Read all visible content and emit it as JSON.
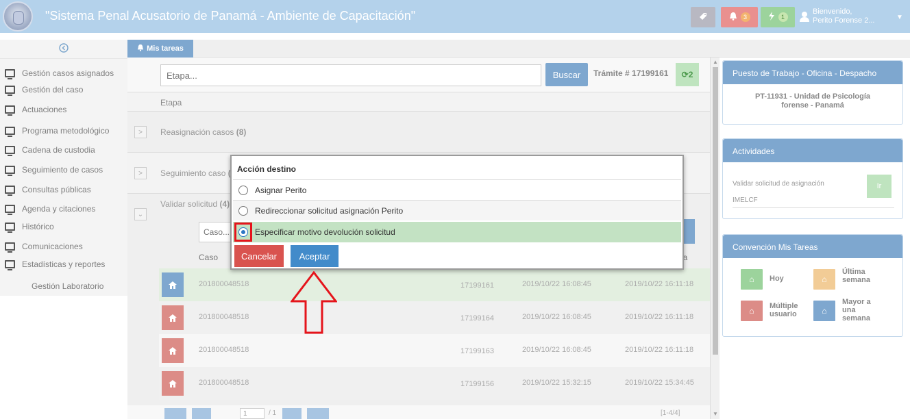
{
  "header": {
    "title": "\"Sistema Penal Acusatorio de Panamá - Ambiente de Capacitación\"",
    "bell_count": "3",
    "bolt_count": "1",
    "user_line1": "Bienvenido,",
    "user_line2": "Perito Forense 2..."
  },
  "sidebar": {
    "items": [
      {
        "label": "Gestión casos asignados"
      },
      {
        "label": "Gestión del caso"
      },
      {
        "label": "Actuaciones"
      },
      {
        "label": "Programa metodológico"
      },
      {
        "label": "Cadena de custodia"
      },
      {
        "label": "Seguimiento de casos"
      },
      {
        "label": "Consultas públicas"
      },
      {
        "label": "Agenda y citaciones"
      },
      {
        "label": "Histórico"
      },
      {
        "label": "Comunicaciones"
      },
      {
        "label": "Estadísticas y reportes"
      }
    ],
    "plain_item": "Gestión Laboratorio"
  },
  "tabs": {
    "active": "Mis tareas"
  },
  "main": {
    "search_placeholder": "Etapa...",
    "search_button": "Buscar",
    "tramite": "Trámite # 17199161",
    "refresh_count": "2",
    "etapa_header": "Etapa",
    "stages": [
      {
        "label": "Reasignación casos",
        "count": "(8)"
      },
      {
        "label": "Seguimiento caso",
        "count": "("
      },
      {
        "label": "Validar solicitud",
        "count": "(4)"
      }
    ],
    "caso_placeholder": "Caso...",
    "col_caso": "Caso",
    "col_area": "rea",
    "rows": [
      {
        "caso": "201800048518",
        "tramite": "17199161",
        "fecha1": "2019/10/22 16:08:45",
        "fecha2": "2019/10/22 16:11:18",
        "color": "#7ea7cf"
      },
      {
        "caso": "201800048518",
        "tramite": "17199164",
        "fecha1": "2019/10/22 16:08:45",
        "fecha2": "2019/10/22 16:11:18",
        "color": "#dc8c87"
      },
      {
        "caso": "201800048518",
        "tramite": "17199163",
        "fecha1": "2019/10/22 16:08:45",
        "fecha2": "2019/10/22 16:11:18",
        "color": "#dc8c87"
      },
      {
        "caso": "201800048518",
        "tramite": "17199156",
        "fecha1": "2019/10/22 15:32:15",
        "fecha2": "2019/10/22 15:34:45",
        "color": "#dc8c87"
      }
    ],
    "pager": {
      "page": "1",
      "of": "/ 1",
      "range": "[1-4/4]"
    }
  },
  "right": {
    "puesto": {
      "title": "Puesto de Trabajo - Oficina - Despacho",
      "line1": "PT-11931 - Unidad de Psicología",
      "line2": "forense - Panamá"
    },
    "actividades": {
      "title": "Actividades",
      "item": "Validar solicitud de asignación",
      "sub": "IMELCF",
      "ir": "Ir"
    },
    "convencion": {
      "title": "Convención Mis Tareas",
      "hoy": "Hoy",
      "ultima_1": "Última",
      "ultima_2": "semana",
      "multiple_1": "Múltiple",
      "multiple_2": "usuario",
      "mayor_1": "Mayor a",
      "mayor_2": "una",
      "mayor_3": "semana",
      "colors": {
        "hoy": "#9cd39c",
        "ultima": "#f2cc96",
        "multiple": "#dc8c87",
        "mayor": "#7ea7cf"
      }
    }
  },
  "modal": {
    "title": "Acción destino",
    "options": [
      {
        "label": "Asignar Perito",
        "selected": false
      },
      {
        "label": "Redireccionar solicitud asignación Perito",
        "selected": false
      },
      {
        "label": "Especificar motivo devolución solicitud",
        "selected": true
      }
    ],
    "cancel": "Cancelar",
    "accept": "Aceptar"
  }
}
